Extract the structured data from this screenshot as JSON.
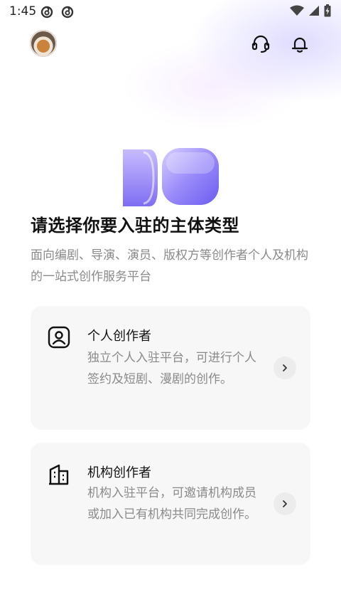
{
  "status_bar": {
    "time": "1:45"
  },
  "header": {
    "icons": [
      "headset-icon",
      "bell-icon"
    ]
  },
  "main": {
    "title": "请选择你要入驻的主体类型",
    "subtitle": "面向编剧、导演、演员、版权方等创作者个人及机构的一站式创作服务平台"
  },
  "cards": [
    {
      "title": "个人创作者",
      "description": "独立个人入驻平台，可进行个人签约及短剧、漫剧的创作。",
      "icon": "person-icon"
    },
    {
      "title": "机构创作者",
      "description": "机构入驻平台，可邀请机构成员或加入已有机构共同完成创作。",
      "icon": "building-icon"
    }
  ],
  "colors": {
    "accent": "#8b7cf6",
    "card_bg": "#f7f7f7",
    "muted_text": "#8a8a8a"
  }
}
